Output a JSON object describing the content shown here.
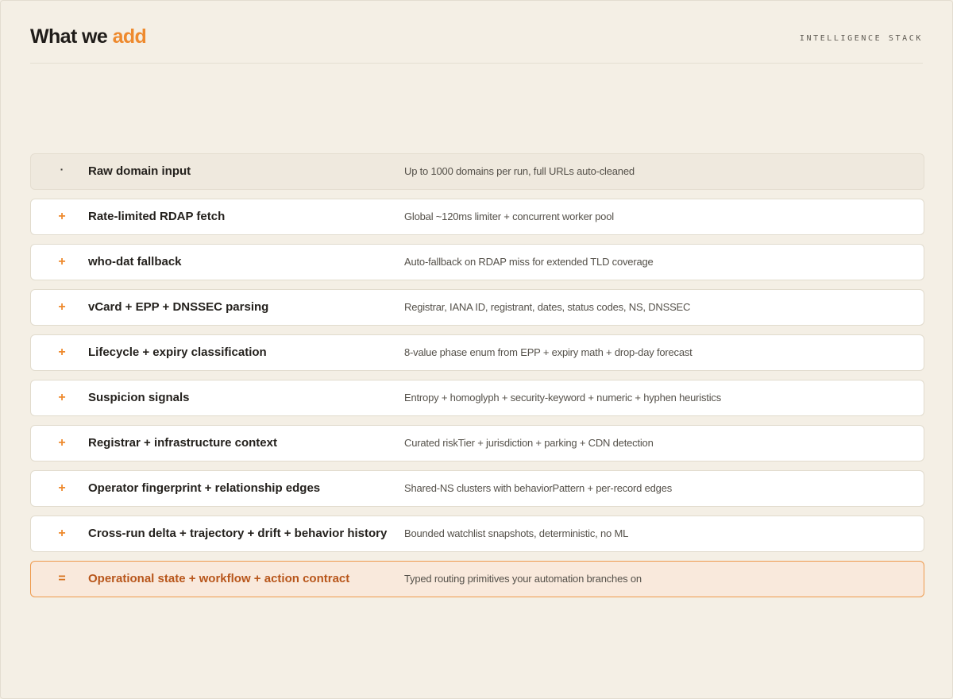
{
  "header": {
    "title_main": "What we",
    "title_accent": "add",
    "eyebrow": "INTELLIGENCE STACK"
  },
  "colors": {
    "background": "#f4efe5",
    "accent": "#ee8a2e",
    "highlight_row_bg": "#f9e9dc",
    "highlight_row_border": "#ee9a4d",
    "highlight_row_text": "#b8561b"
  },
  "rows": [
    {
      "marker": "·",
      "label": "Raw domain input",
      "description": "Up to 1000 domains per run, full URLs auto-cleaned"
    },
    {
      "marker": "+",
      "label": "Rate-limited RDAP fetch",
      "description": "Global ~120ms limiter + concurrent worker pool"
    },
    {
      "marker": "+",
      "label": "who-dat fallback",
      "description": "Auto-fallback on RDAP miss for extended TLD coverage"
    },
    {
      "marker": "+",
      "label": "vCard + EPP + DNSSEC parsing",
      "description": "Registrar, IANA ID, registrant, dates, status codes, NS, DNSSEC"
    },
    {
      "marker": "+",
      "label": "Lifecycle + expiry classification",
      "description": "8-value phase enum from EPP + expiry math + drop-day forecast"
    },
    {
      "marker": "+",
      "label": "Suspicion signals",
      "description": "Entropy + homoglyph + security-keyword + numeric + hyphen heuristics"
    },
    {
      "marker": "+",
      "label": "Registrar + infrastructure context",
      "description": "Curated riskTier + jurisdiction + parking + CDN detection"
    },
    {
      "marker": "+",
      "label": "Operator fingerprint + relationship edges",
      "description": "Shared-NS clusters with behaviorPattern + per-record edges"
    },
    {
      "marker": "+",
      "label": "Cross-run delta + trajectory + drift + behavior history",
      "description": "Bounded watchlist snapshots, deterministic, no ML"
    },
    {
      "marker": "=",
      "label": "Operational state + workflow + action contract",
      "description": "Typed routing primitives your automation branches on"
    }
  ]
}
